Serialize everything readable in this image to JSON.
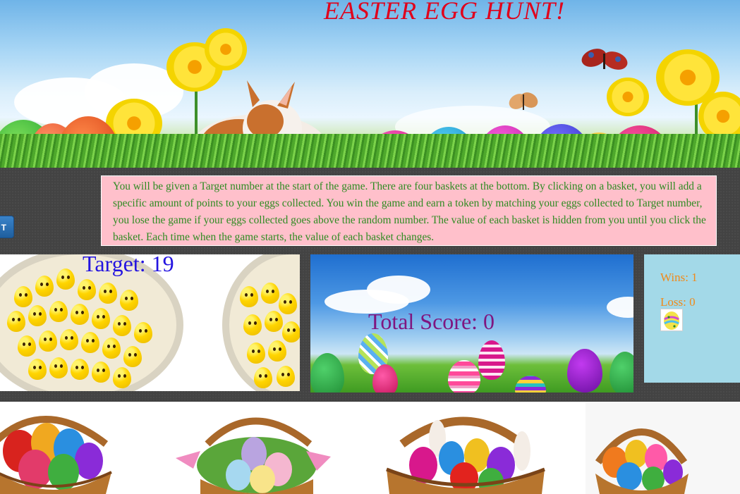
{
  "header": {
    "title": "EASTER EGG HUNT!"
  },
  "controls": {
    "start_label": "T"
  },
  "instructions": {
    "text": "You will be given a Target number at the start of the game. There are four baskets at the bottom. By clicking on a basket, you will add a specific amount of points to your eggs collected. You win the game and earn a token by matching your eggs collected to Target number, you lose the game if your eggs collected goes above the random number. The value of each basket is hidden from you until you click the basket. Each time when the game starts, the value of each basket changes."
  },
  "game": {
    "target_text": "Target: 19",
    "score_text": "Total Score: 0",
    "wins_text": "Wins: 1",
    "loss_text": "Loss: 0",
    "tokens_earned": 1
  },
  "colors": {
    "title": "#e0001b",
    "instructions_bg": "#ffc0cb",
    "instructions_text": "#2e8b22",
    "target_text": "#2414e0",
    "score_text": "#7f1680",
    "stats_bg": "#a3d9e8",
    "stats_text": "#f08a1a"
  },
  "baskets": [
    {
      "name": "basket-1",
      "icon": "decorated-eggs-basket-icon"
    },
    {
      "name": "basket-2",
      "icon": "pastel-eggs-basket-icon"
    },
    {
      "name": "basket-3",
      "icon": "bunny-chocolate-eggs-basket-icon"
    },
    {
      "name": "basket-4",
      "icon": "colorful-eggs-basket-icon"
    }
  ]
}
